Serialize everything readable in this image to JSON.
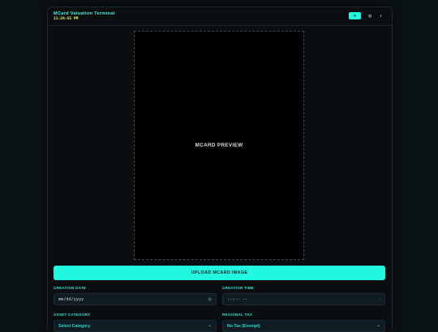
{
  "header": {
    "title": "MCard Valuation Terminal",
    "clock": "11:26:55 PM",
    "buttons": [
      {
        "icon": "sun-icon",
        "glyph": "☀",
        "active": true
      },
      {
        "icon": "monitor-icon",
        "glyph": "◍",
        "active": false
      },
      {
        "icon": "contrast-icon",
        "glyph": "◐",
        "active": false
      }
    ]
  },
  "preview": {
    "label": "MCARD PREVIEW"
  },
  "upload": {
    "label": "UPLOAD MCARD IMAGE"
  },
  "form": {
    "creation_date": {
      "label": "CREATION DATE",
      "placeholder": "mm/dd/yyyy",
      "icon": "calendar-icon"
    },
    "creation_time": {
      "label": "CREATION TIME",
      "placeholder": "--:-- --",
      "icon": "clock-icon"
    },
    "asset_category": {
      "label": "ASSET CATEGORY",
      "value": "Select Category"
    },
    "regional_tax": {
      "label": "REGIONAL TAX",
      "value": "No Tax (Exempt)"
    }
  },
  "colors": {
    "accent": "#22f7e0",
    "clock": "#e9f95a",
    "background": "#0a0e11"
  }
}
